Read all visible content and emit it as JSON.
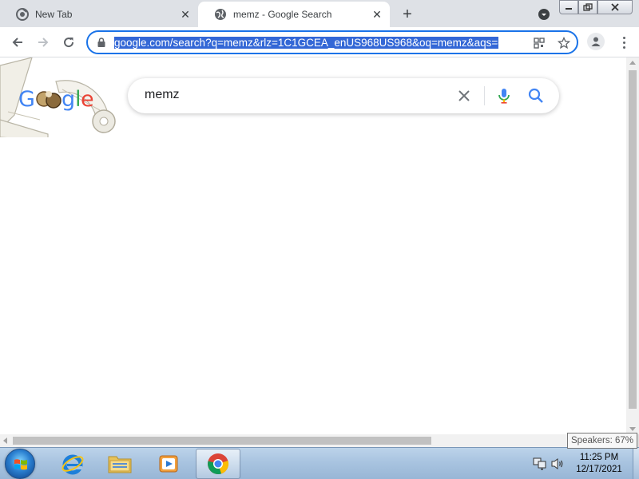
{
  "tabs": [
    {
      "title": "New Tab",
      "icon": "chrome-icon",
      "close": "✕"
    },
    {
      "title": "memz - Google Search",
      "icon": "globe-icon",
      "close": "✕"
    }
  ],
  "tabstrip": {
    "new_tab_label": "+"
  },
  "omnibox": {
    "url": "google.com/search?q=memz&rlz=1C1GCEA_enUS968US968&oq=memz&aqs=chrome"
  },
  "search": {
    "query": "memz",
    "clear_label": "✕"
  },
  "tooltip": {
    "text": "Speakers: 67%"
  },
  "taskbar": {
    "time": "11:25 PM",
    "date": "12/17/2021",
    "pinned": [
      "internet-explorer-icon",
      "file-explorer-icon",
      "media-player-icon",
      "chrome-icon"
    ]
  },
  "colors": {
    "accent": "#1a73e8",
    "url_highlight": "#3367d6",
    "tabstrip_bg": "#dee1e6",
    "taskbar_bg": "#a9c4e0"
  }
}
